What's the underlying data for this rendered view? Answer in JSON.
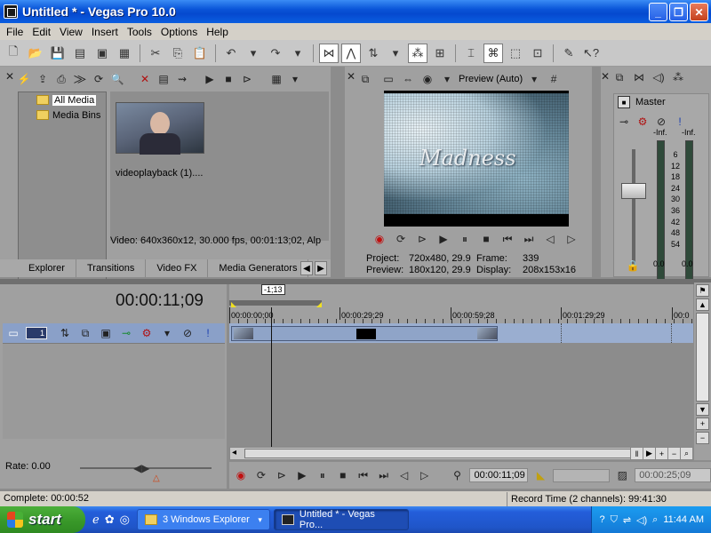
{
  "window": {
    "title": "Untitled * - Vegas Pro 10.0",
    "controls": [
      "_",
      "❐",
      "✕"
    ]
  },
  "menu": [
    "File",
    "Edit",
    "View",
    "Insert",
    "Tools",
    "Options",
    "Help"
  ],
  "explorer": {
    "tree": [
      "All Media",
      "Media Bins"
    ],
    "file_caption": "videoplayback (1)....",
    "video_info": "Video: 640x360x12, 30.000 fps, 00:01:13;02, Alp",
    "tabs": [
      "Explorer",
      "Transitions",
      "Video FX",
      "Media Generators"
    ]
  },
  "preview": {
    "mode": "Preview (Auto)",
    "overlay_text": "Madness",
    "info": {
      "project_label": "Project:",
      "project_value": "720x480, 29.9",
      "frame_label": "Frame:",
      "frame_value": "339",
      "preview_label": "Preview:",
      "preview_value": "180x120, 29.9",
      "display_label": "Display:",
      "display_value": "208x153x16"
    }
  },
  "mixer": {
    "master_label": "Master",
    "peak_left": "-Inf.",
    "peak_right": "-Inf.",
    "scale": [
      "6",
      "12",
      "18",
      "24",
      "30",
      "36",
      "42",
      "48",
      "54"
    ],
    "level_left": "0.0",
    "level_right": "0.0"
  },
  "timeline": {
    "timecode": "00:00:11;09",
    "track_number": "1",
    "marker_label": "-1;13",
    "ruler_labels": [
      "00:00:00;00",
      "00:00:29;29",
      "00:00:59;28",
      "00:01:29;29",
      "00:0"
    ],
    "rate_label": "Rate: 0.00",
    "transport_time": "00:00:11;09",
    "transport_end": "00:00:25;09"
  },
  "status": {
    "complete": "Complete: 00:00:52",
    "record_time": "Record Time (2 channels): 99:41:30"
  },
  "taskbar": {
    "start_label": "start",
    "tasks": [
      "3 Windows Explorer",
      "Untitled * - Vegas Pro..."
    ],
    "clock": "11:44 AM"
  }
}
